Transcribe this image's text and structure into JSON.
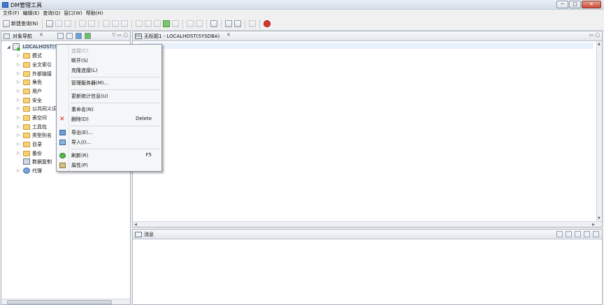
{
  "window": {
    "title": "DM管理工具",
    "min_label": "─",
    "max_label": "□",
    "close_label": "✕"
  },
  "menubar": {
    "items": [
      "文件(F)",
      "编辑(E)",
      "查询(Q)",
      "窗口(W)",
      "帮助(H)"
    ]
  },
  "toolbar": {
    "new_query_label": "新建查询(N)"
  },
  "navigator": {
    "tab_label": "对象导航",
    "tab_close": "✕",
    "minmax": "▽ ▭ ▢",
    "root_label": "LOCALHOST(SYSDBA)",
    "items": [
      {
        "label": "模式",
        "icon": "folder-icon"
      },
      {
        "label": "全文索引",
        "icon": "folder-icon"
      },
      {
        "label": "外部链接",
        "icon": "folder-icon"
      },
      {
        "label": "角色",
        "icon": "folder-icon"
      },
      {
        "label": "用户",
        "icon": "folder-icon"
      },
      {
        "label": "安全",
        "icon": "folder-icon"
      },
      {
        "label": "公共同义词",
        "icon": "folder-icon"
      },
      {
        "label": "表空间",
        "icon": "folder-icon"
      },
      {
        "label": "工具包",
        "icon": "folder-icon"
      },
      {
        "label": "类型别名",
        "icon": "folder-icon"
      },
      {
        "label": "目录",
        "icon": "folder-icon"
      },
      {
        "label": "备份",
        "icon": "folder-icon"
      },
      {
        "label": "数据复制",
        "icon": "db-copy-icon"
      },
      {
        "label": "代理",
        "icon": "agent-icon"
      }
    ]
  },
  "editor": {
    "tab_label": "无标题1 - LOCALHOST(SYSDBA)",
    "tab_close": "✕",
    "sql_badge": "SQL",
    "minmax": "▭ ▢"
  },
  "messages": {
    "tab_label": "消息"
  },
  "context_menu": {
    "items": [
      {
        "label": "连接(C)",
        "shortcut": "",
        "disabled": true
      },
      {
        "label": "断开(S)",
        "shortcut": "",
        "disabled": false
      },
      {
        "label": "克隆连接(L)",
        "shortcut": "",
        "disabled": false
      },
      {
        "label": "管理服务器(M)...",
        "shortcut": "",
        "disabled": false
      },
      {
        "label": "更新统计信息(U)",
        "shortcut": "",
        "disabled": false
      },
      {
        "label": "重命名(N)",
        "shortcut": "",
        "disabled": false
      },
      {
        "label": "删除(D)",
        "shortcut": "Delete",
        "disabled": false
      },
      {
        "label": "导出(E)...",
        "shortcut": "",
        "disabled": false
      },
      {
        "label": "导入(I)...",
        "shortcut": "",
        "disabled": false
      },
      {
        "label": "刷新(R)",
        "shortcut": "F5",
        "disabled": false
      },
      {
        "label": "属性(P)",
        "shortcut": "",
        "disabled": false
      }
    ]
  }
}
